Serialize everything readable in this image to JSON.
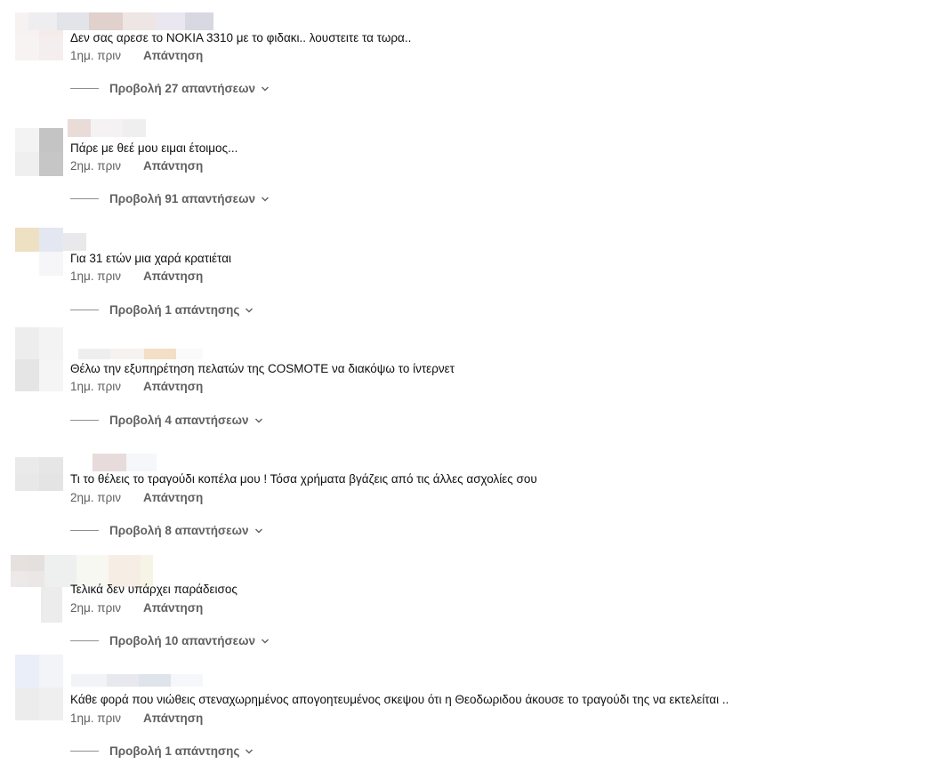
{
  "comments": [
    {
      "text": "Δεν σας αρεσε το NOKIA 3310 με το φιδακι.. λουστειτε τα τωρα..",
      "time": "1ημ. πριν",
      "reply": "Απάντηση",
      "replies": "Προβολή 27 απαντήσεων"
    },
    {
      "text": "Πάρε με θεέ μου ειμαι έτοιμος...",
      "time": "2ημ. πριν",
      "reply": "Απάντηση",
      "replies": "Προβολή 91 απαντήσεων"
    },
    {
      "text": "Για 31 ετών μια χαρά κρατιέται",
      "time": "1ημ. πριν",
      "reply": "Απάντηση",
      "replies": "Προβολή 1 απάντησης"
    },
    {
      "text": "Θέλω την εξυπηρέτηση πελατών της COSMOTE να διακόψω το ίντερνετ",
      "time": "1ημ. πριν",
      "reply": "Απάντηση",
      "replies": "Προβολή 4 απαντήσεων"
    },
    {
      "text": "Τι το θέλεις το τραγούδι κοπέλα μου ! Τόσα χρήματα βγάζεις από τις άλλες ασχολίες σου",
      "time": "2ημ. πριν",
      "reply": "Απάντηση",
      "replies": "Προβολή 8 απαντήσεων"
    },
    {
      "text": "Τελικά δεν υπάρχει παράδεισος",
      "time": "2ημ. πριν",
      "reply": "Απάντηση",
      "replies": "Προβολή 10 απαντήσεων"
    },
    {
      "text": "Κάθε φορά που νιώθεις στεναχωρημένος απογοητευμένος σκεψου ότι η Θεοδωριδου άκουσε το τραγούδι της να εκτελείται ..",
      "time": "1ημ. πριν",
      "reply": "Απάντηση",
      "replies": "Προβολή 1 απάντησης"
    }
  ],
  "colors": {
    "text": "#0f0f0f",
    "secondary": "#606060"
  },
  "icons": {
    "expand": "chevron-down-icon"
  }
}
